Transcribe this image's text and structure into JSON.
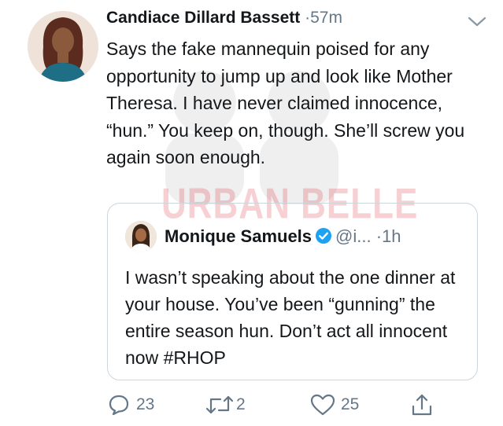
{
  "tweet": {
    "author_name": "Candiace Dillard Bassett",
    "separator": "·",
    "time": "57m",
    "text": "Says the fake mannequin poised for any opportunity to jump up and look like Mother Theresa. I have never claimed innocence, “hun.” You keep on, though. She’ll screw you again soon enough."
  },
  "quoted": {
    "author_name": "Monique Samuels",
    "handle": "@i...",
    "separator": "·",
    "time": "1h",
    "text": "I wasn’t speaking about the one dinner at your house. You’ve been “gunning” the entire season hun. Don’t act all innocent now #RHOP"
  },
  "actions": {
    "replies": "23",
    "retweets": "2",
    "likes": "25"
  },
  "watermark": "URBAN BELLE",
  "icons": {
    "menu": "chevron-down-icon",
    "verified": "verified-badge-icon",
    "reply": "reply-icon",
    "retweet": "retweet-icon",
    "like": "heart-icon",
    "share": "share-icon"
  },
  "colors": {
    "text": "#14171a",
    "secondary": "#657786",
    "verified": "#1da1f2",
    "border": "#ccd6dd",
    "watermark": "#dc283c"
  }
}
